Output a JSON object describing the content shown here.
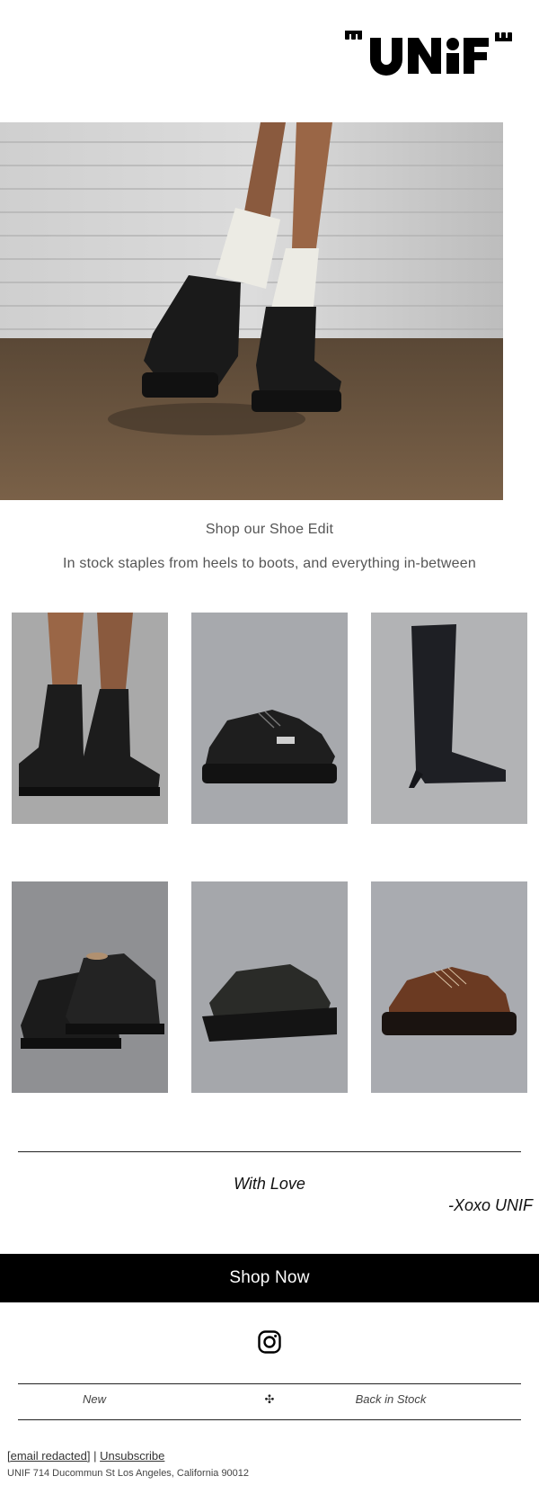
{
  "brand": {
    "logo_text": "UNIF"
  },
  "intro": {
    "headline": "Shop our Shoe Edit",
    "subline": "In stock staples from heels to boots, and everything in-between"
  },
  "products": [
    {
      "icon": "lace-up-combat-boots-image"
    },
    {
      "icon": "platform-oxford-image"
    },
    {
      "icon": "knee-high-kitten-heel-boot-image"
    },
    {
      "icon": "black-derby-shoes-image"
    },
    {
      "icon": "wedge-loafer-image"
    },
    {
      "icon": "brown-platform-derby-image"
    }
  ],
  "signoff": {
    "with_love": "With Love",
    "xoxo": "-Xoxo UNIF"
  },
  "cta": {
    "label": "Shop Now"
  },
  "social": {
    "instagram_icon": "instagram-icon"
  },
  "footer_nav": {
    "new": "New",
    "separator": "✣",
    "back_in_stock": "Back in Stock"
  },
  "legal": {
    "email": "[email redacted]",
    "divider": " | ",
    "unsubscribe": "Unsubscribe",
    "address": "UNIF 714 Ducommun St Los Angeles, California 90012"
  },
  "colors": {
    "background": "#ffffff",
    "cta_background": "#000000",
    "cta_text": "#ffffff",
    "text_muted": "#555555"
  }
}
